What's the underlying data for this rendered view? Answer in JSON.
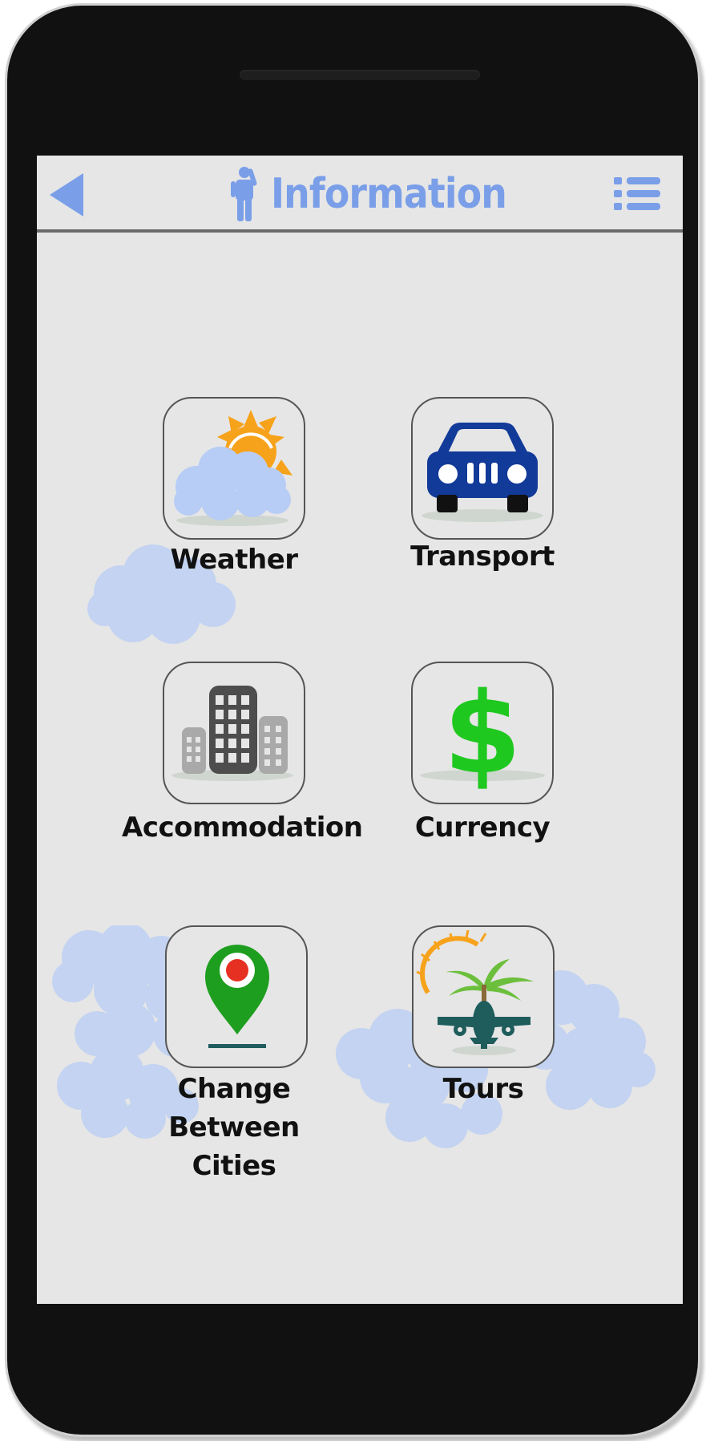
{
  "header": {
    "title": "Information",
    "back_icon": "back-arrow-icon",
    "menu_icon": "list-menu-icon",
    "person_icon": "person-info-icon",
    "accent_color": "#7a9fe8"
  },
  "menu": {
    "items": [
      {
        "label": "Weather",
        "icon": "weather-icon"
      },
      {
        "label": "Transport",
        "icon": "car-icon"
      },
      {
        "label": "Accommodation",
        "icon": "buildings-icon"
      },
      {
        "label": "Currency",
        "icon": "dollar-icon"
      },
      {
        "label": "Change Between",
        "label_line2": "Cities",
        "icon": "map-pin-icon"
      },
      {
        "label": "Tours",
        "icon": "tours-plane-icon"
      }
    ]
  },
  "colors": {
    "screen_bg": "#e6e6e6",
    "phone_body": "#111111",
    "cloud": "#b8cdf5",
    "sun": "#f7a21b",
    "car": "#123a99",
    "dollar": "#1fc81f",
    "pin_green": "#1e9e1e",
    "pin_red": "#e63022",
    "plane": "#1f5c5c",
    "palm": "#6cbf3c"
  }
}
